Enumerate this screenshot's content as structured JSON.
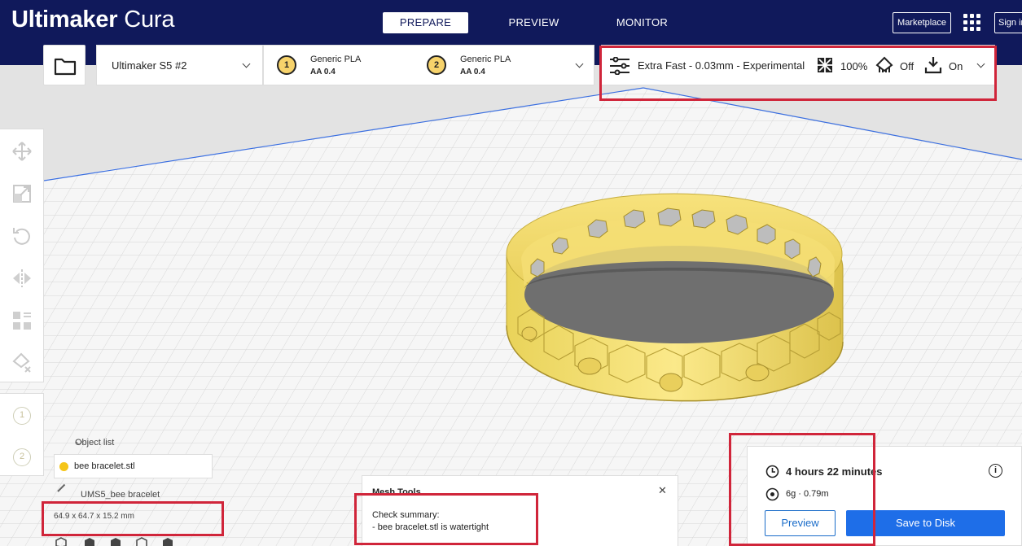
{
  "app": {
    "brand_bold": "Ultimaker",
    "brand_light": " Cura"
  },
  "stages": [
    {
      "label": "PREPARE",
      "active": true
    },
    {
      "label": "PREVIEW",
      "active": false
    },
    {
      "label": "MONITOR",
      "active": false
    }
  ],
  "header": {
    "marketplace_label": "Marketplace",
    "signin_label": "Sign in"
  },
  "printer": {
    "name": "Ultimaker S5 #2"
  },
  "extruders": [
    {
      "number": "1",
      "material": "Generic PLA",
      "core": "AA 0.4"
    },
    {
      "number": "2",
      "material": "Generic PLA",
      "core": "AA 0.4"
    }
  ],
  "print_settings": {
    "profile": "Extra Fast - 0.03mm - Experimental",
    "infill": "100%",
    "support": "Off",
    "adhesion": "On"
  },
  "left_extruders": [
    "1",
    "2"
  ],
  "object_list": {
    "header": "Object list",
    "items": [
      {
        "name": "bee bracelet.stl",
        "color": "#f5c518"
      }
    ],
    "job_name": "UMS5_bee bracelet",
    "dimensions": "64.9 x 64.7 x 15.2 mm"
  },
  "mesh_tools": {
    "title": "Mesh Tools",
    "summary_label": "Check summary:",
    "summary_line": "- bee bracelet.stl is watertight"
  },
  "action_panel": {
    "print_time": "4 hours 22 minutes",
    "material_usage": "6g · 0.79m",
    "preview_label": "Preview",
    "save_label": "Save to Disk"
  },
  "colors": {
    "header_bg": "#10195b",
    "accent_blue": "#1e6ee8",
    "model_yellow": "#f5e37a",
    "annotation_red": "#d0253a"
  }
}
